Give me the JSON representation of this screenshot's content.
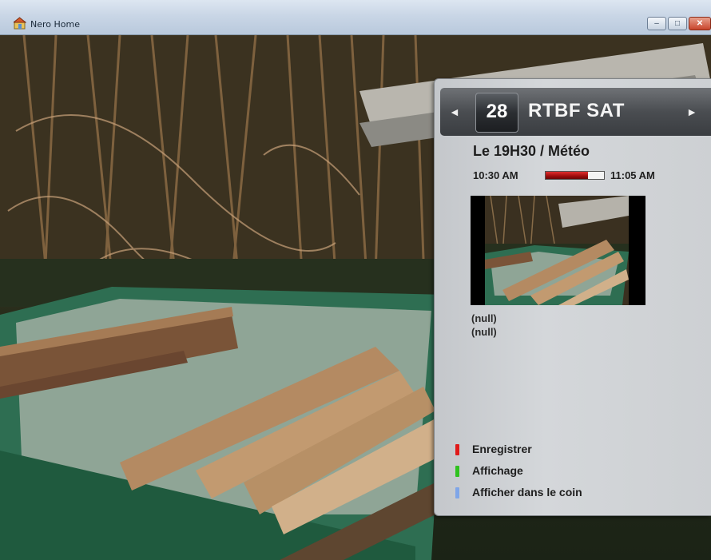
{
  "window": {
    "title": "Nero Home",
    "controls": {
      "minimize": "–",
      "maximize": "□",
      "close": "✕"
    }
  },
  "osd": {
    "channel": {
      "number": "28",
      "name": "RTBF SAT",
      "prev_icon": "◄",
      "next_icon": "►"
    },
    "program": {
      "title": "Le 19H30 / Météo",
      "start_time": "10:30 AM",
      "end_time": "11:05 AM",
      "progress": 0.72
    },
    "details": [
      "(null)",
      "(null)"
    ],
    "legend": [
      {
        "label": "Enregistrer",
        "color": "#e01a1a"
      },
      {
        "label": "Affichage",
        "color": "#2fc21f"
      },
      {
        "label": "Afficher dans le coin",
        "color": "#7fa6e8"
      }
    ]
  },
  "colors": {
    "panel": "#cdd0d3",
    "channel_bar": "#4a4d51",
    "progress": "#b51212"
  }
}
